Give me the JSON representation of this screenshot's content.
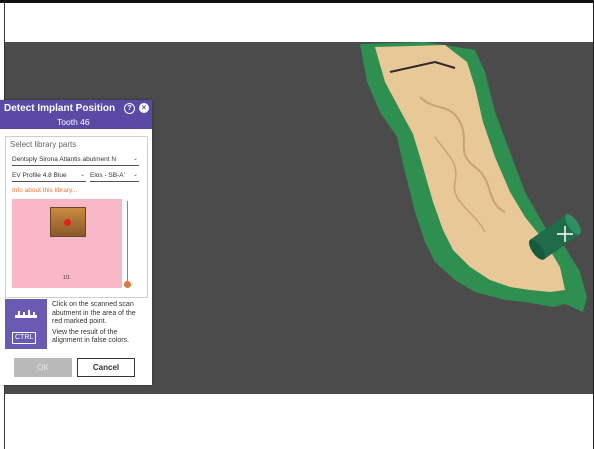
{
  "dialog": {
    "title": "Detect Implant Position",
    "subtitle": "Tooth 46",
    "help_icon": "help-icon",
    "close_icon": "close-icon",
    "library": {
      "label": "Select library parts",
      "manufacturer_select": "Dentsply Sirona Atlantis abutment N",
      "profile_select": "EV Profile 4.8 Blue",
      "type_select": "Elos - SB-A'",
      "info_link": "Info about this library...",
      "preview_page": "1/1"
    },
    "hint": {
      "icon": "scan-abutment-icon",
      "key_label": "CTRL",
      "line1": "Click on the scanned scan abutment in the area of the red marked point.",
      "line2": "View the result of the alignment in false colors."
    },
    "buttons": {
      "ok": "OK",
      "cancel": "Cancel"
    }
  },
  "colors": {
    "header": "#5a4aa6",
    "viewport_bg": "#4b4b4b",
    "gum": "#2f8f50",
    "tooth": "#e9c898",
    "accent": "#e0783c",
    "preview_bg": "#f8b7c7"
  }
}
